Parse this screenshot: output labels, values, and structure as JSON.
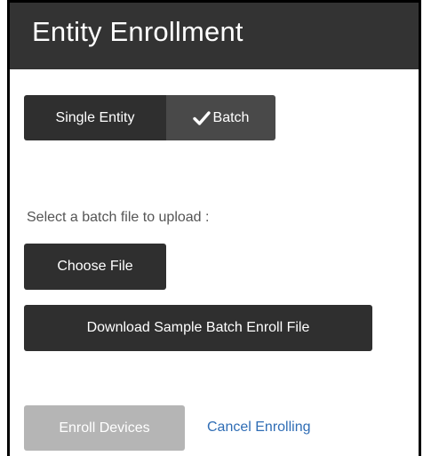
{
  "header": {
    "title": "Entity Enrollment"
  },
  "mode_toggle": {
    "single_label": "Single Entity",
    "batch_label": "Batch",
    "selected": "Batch",
    "check_icon": "checkmark-icon"
  },
  "upload": {
    "prompt": "Select a batch file to upload :",
    "choose_file_label": "Choose File",
    "download_sample_label": "Download Sample Batch Enroll File"
  },
  "actions": {
    "enroll_label": "Enroll Devices",
    "enroll_enabled": false,
    "cancel_label": "Cancel Enrolling"
  },
  "colors": {
    "header_bg": "#333333",
    "button_dark": "#2f2f2f",
    "button_selected": "#494949",
    "button_disabled": "#b5b5b5",
    "link": "#2f6db5"
  }
}
